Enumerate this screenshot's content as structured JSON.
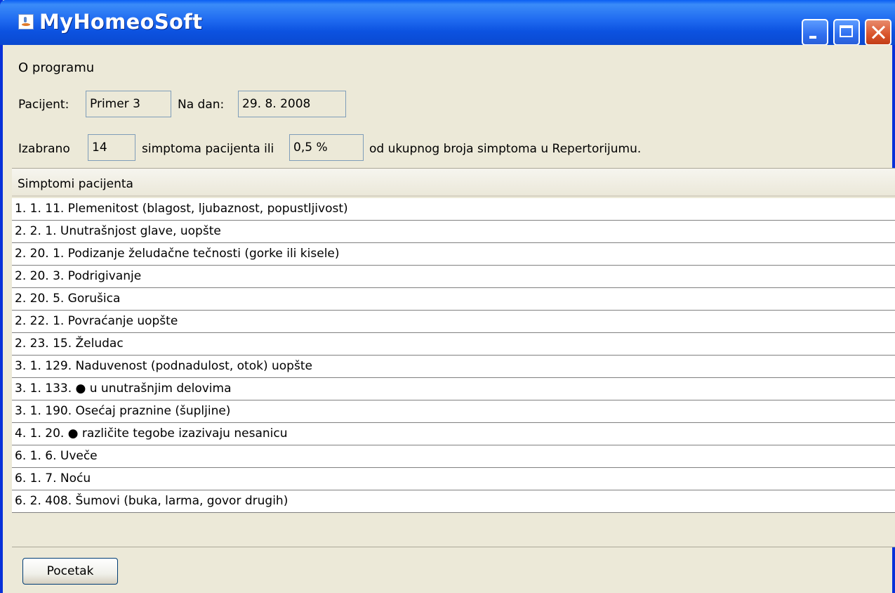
{
  "window": {
    "title": "MyHomeoSoft",
    "title_color": "#ffffff",
    "accent": "#0a4ee0",
    "icons": [
      "java-app-icon",
      "minimize-icon",
      "maximize-icon",
      "close-icon"
    ]
  },
  "menu": {
    "items": [
      "O programu"
    ]
  },
  "patient": {
    "patient_label": "Pacijent:",
    "patient_value": "Primer 3",
    "date_label": "Na dan:",
    "date_value": "29. 8. 2008"
  },
  "summary": {
    "selected_label": "Izabrano",
    "selected_count": "14",
    "middle_text": "simptoma pacijenta ili",
    "percent": "0,5 %",
    "tail_text": "od ukupnog broja simptoma u Repertorijumu."
  },
  "table": {
    "header": "Simptomi pacijenta",
    "rows": [
      "1. 1. 11. Plemenitost (blagost, ljubaznost, popustljivost)",
      "2. 2. 1. Unutrašnjost glave, uopšte",
      "2. 20. 1. Podizanje želudačne tečnosti (gorke ili kisele)",
      "2. 20. 3. Podrigivanje",
      "2. 20. 5. Gorušica",
      "2. 22. 1. Povraćanje uopšte",
      "2. 23. 15.  Želudac",
      "3. 1. 129. Naduvenost (podnadulost, otok) uopšte",
      "3. 1. 133. ● u unutrašnjim delovima",
      "3. 1. 190. Osećaj praznine (šupljine)",
      "4. 1. 20. ● različite tegobe izazivaju nesanicu",
      "6. 1. 6. Uveče",
      "6. 1. 7. Noću",
      "6. 2. 408. Šumovi (buka, larma, govor drugih)"
    ]
  },
  "buttons": {
    "start": "Pocetak"
  }
}
